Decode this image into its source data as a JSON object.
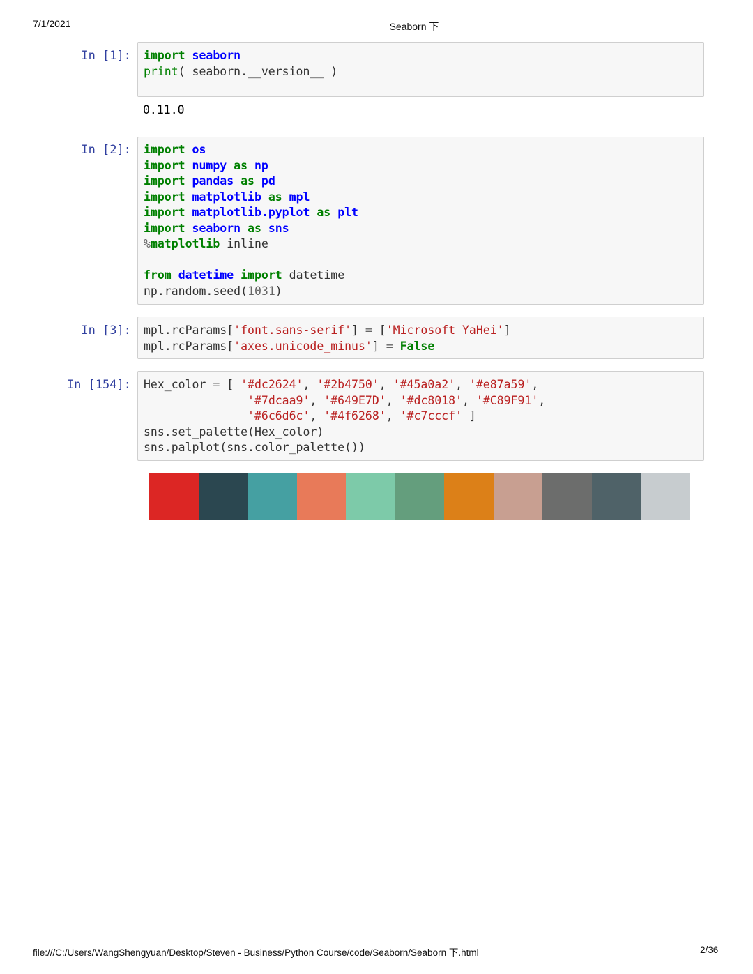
{
  "page_header": {
    "date": "7/1/2021",
    "title": "Seaborn 下"
  },
  "page_footer": {
    "path": "file:///C:/Users/WangShengyuan/Desktop/Steven - Business/Python Course/code/Seaborn/Seaborn 下.html",
    "page": "2/36"
  },
  "cells": {
    "c1": {
      "prompt": "In [1]:",
      "t": {
        "import": "import",
        "seaborn": "seaborn",
        "print": "print",
        "rest": "( seaborn.__version__ )"
      },
      "output": "0.11.0"
    },
    "c2": {
      "prompt": "In [2]:",
      "t": {
        "import": "import",
        "as": "as",
        "from": "from",
        "os": "os",
        "numpy": "numpy",
        "np": "np",
        "pandas": "pandas",
        "pd": "pd",
        "matplotlib": "matplotlib",
        "mpl": "mpl",
        "pyplot": "matplotlib.pyplot",
        "plt": "plt",
        "seaborn": "seaborn",
        "sns": "sns",
        "pct": "%",
        "mpl_magic": "matplotlib",
        "inline": " inline",
        "datetime_mod": "datetime",
        "datetime_name": " datetime",
        "seed_call": "np.random.seed(",
        "seed_val": "1031",
        "seed_close": ")"
      }
    },
    "c3": {
      "prompt": "In [3]:",
      "t": {
        "l1a": "mpl.rcParams[",
        "l1s": "'font.sans-serif'",
        "l1b": "] ",
        "eq": "=",
        "l1c": " [",
        "l1v": "'Microsoft YaHei'",
        "l1d": "]",
        "l2a": "mpl.rcParams[",
        "l2s": "'axes.unicode_minus'",
        "l2b": "] ",
        "l2c": " ",
        "false": "False"
      }
    },
    "c4": {
      "prompt": "In [154]:",
      "t": {
        "var": "Hex_color ",
        "eq": "=",
        "open": " [ ",
        "comma": ", ",
        "pad": "               ",
        "close": " ]",
        "call1": "sns.set_palette(Hex_color)",
        "call2": "sns.palplot(sns.color_palette())"
      },
      "hex_strings": [
        "'#dc2624'",
        "'#2b4750'",
        "'#45a0a2'",
        "'#e87a59'",
        "'#7dcaa9'",
        "'#649E7D'",
        "'#dc8018'",
        "'#C89F91'",
        "'#6c6d6c'",
        "'#4f6268'",
        "'#c7cccf'"
      ],
      "palette": [
        "#dc2624",
        "#2b4750",
        "#45a0a2",
        "#e87a59",
        "#7dcaa9",
        "#649E7D",
        "#dc8018",
        "#C89F91",
        "#6c6d6c",
        "#4f6268",
        "#c7cccf"
      ]
    }
  }
}
